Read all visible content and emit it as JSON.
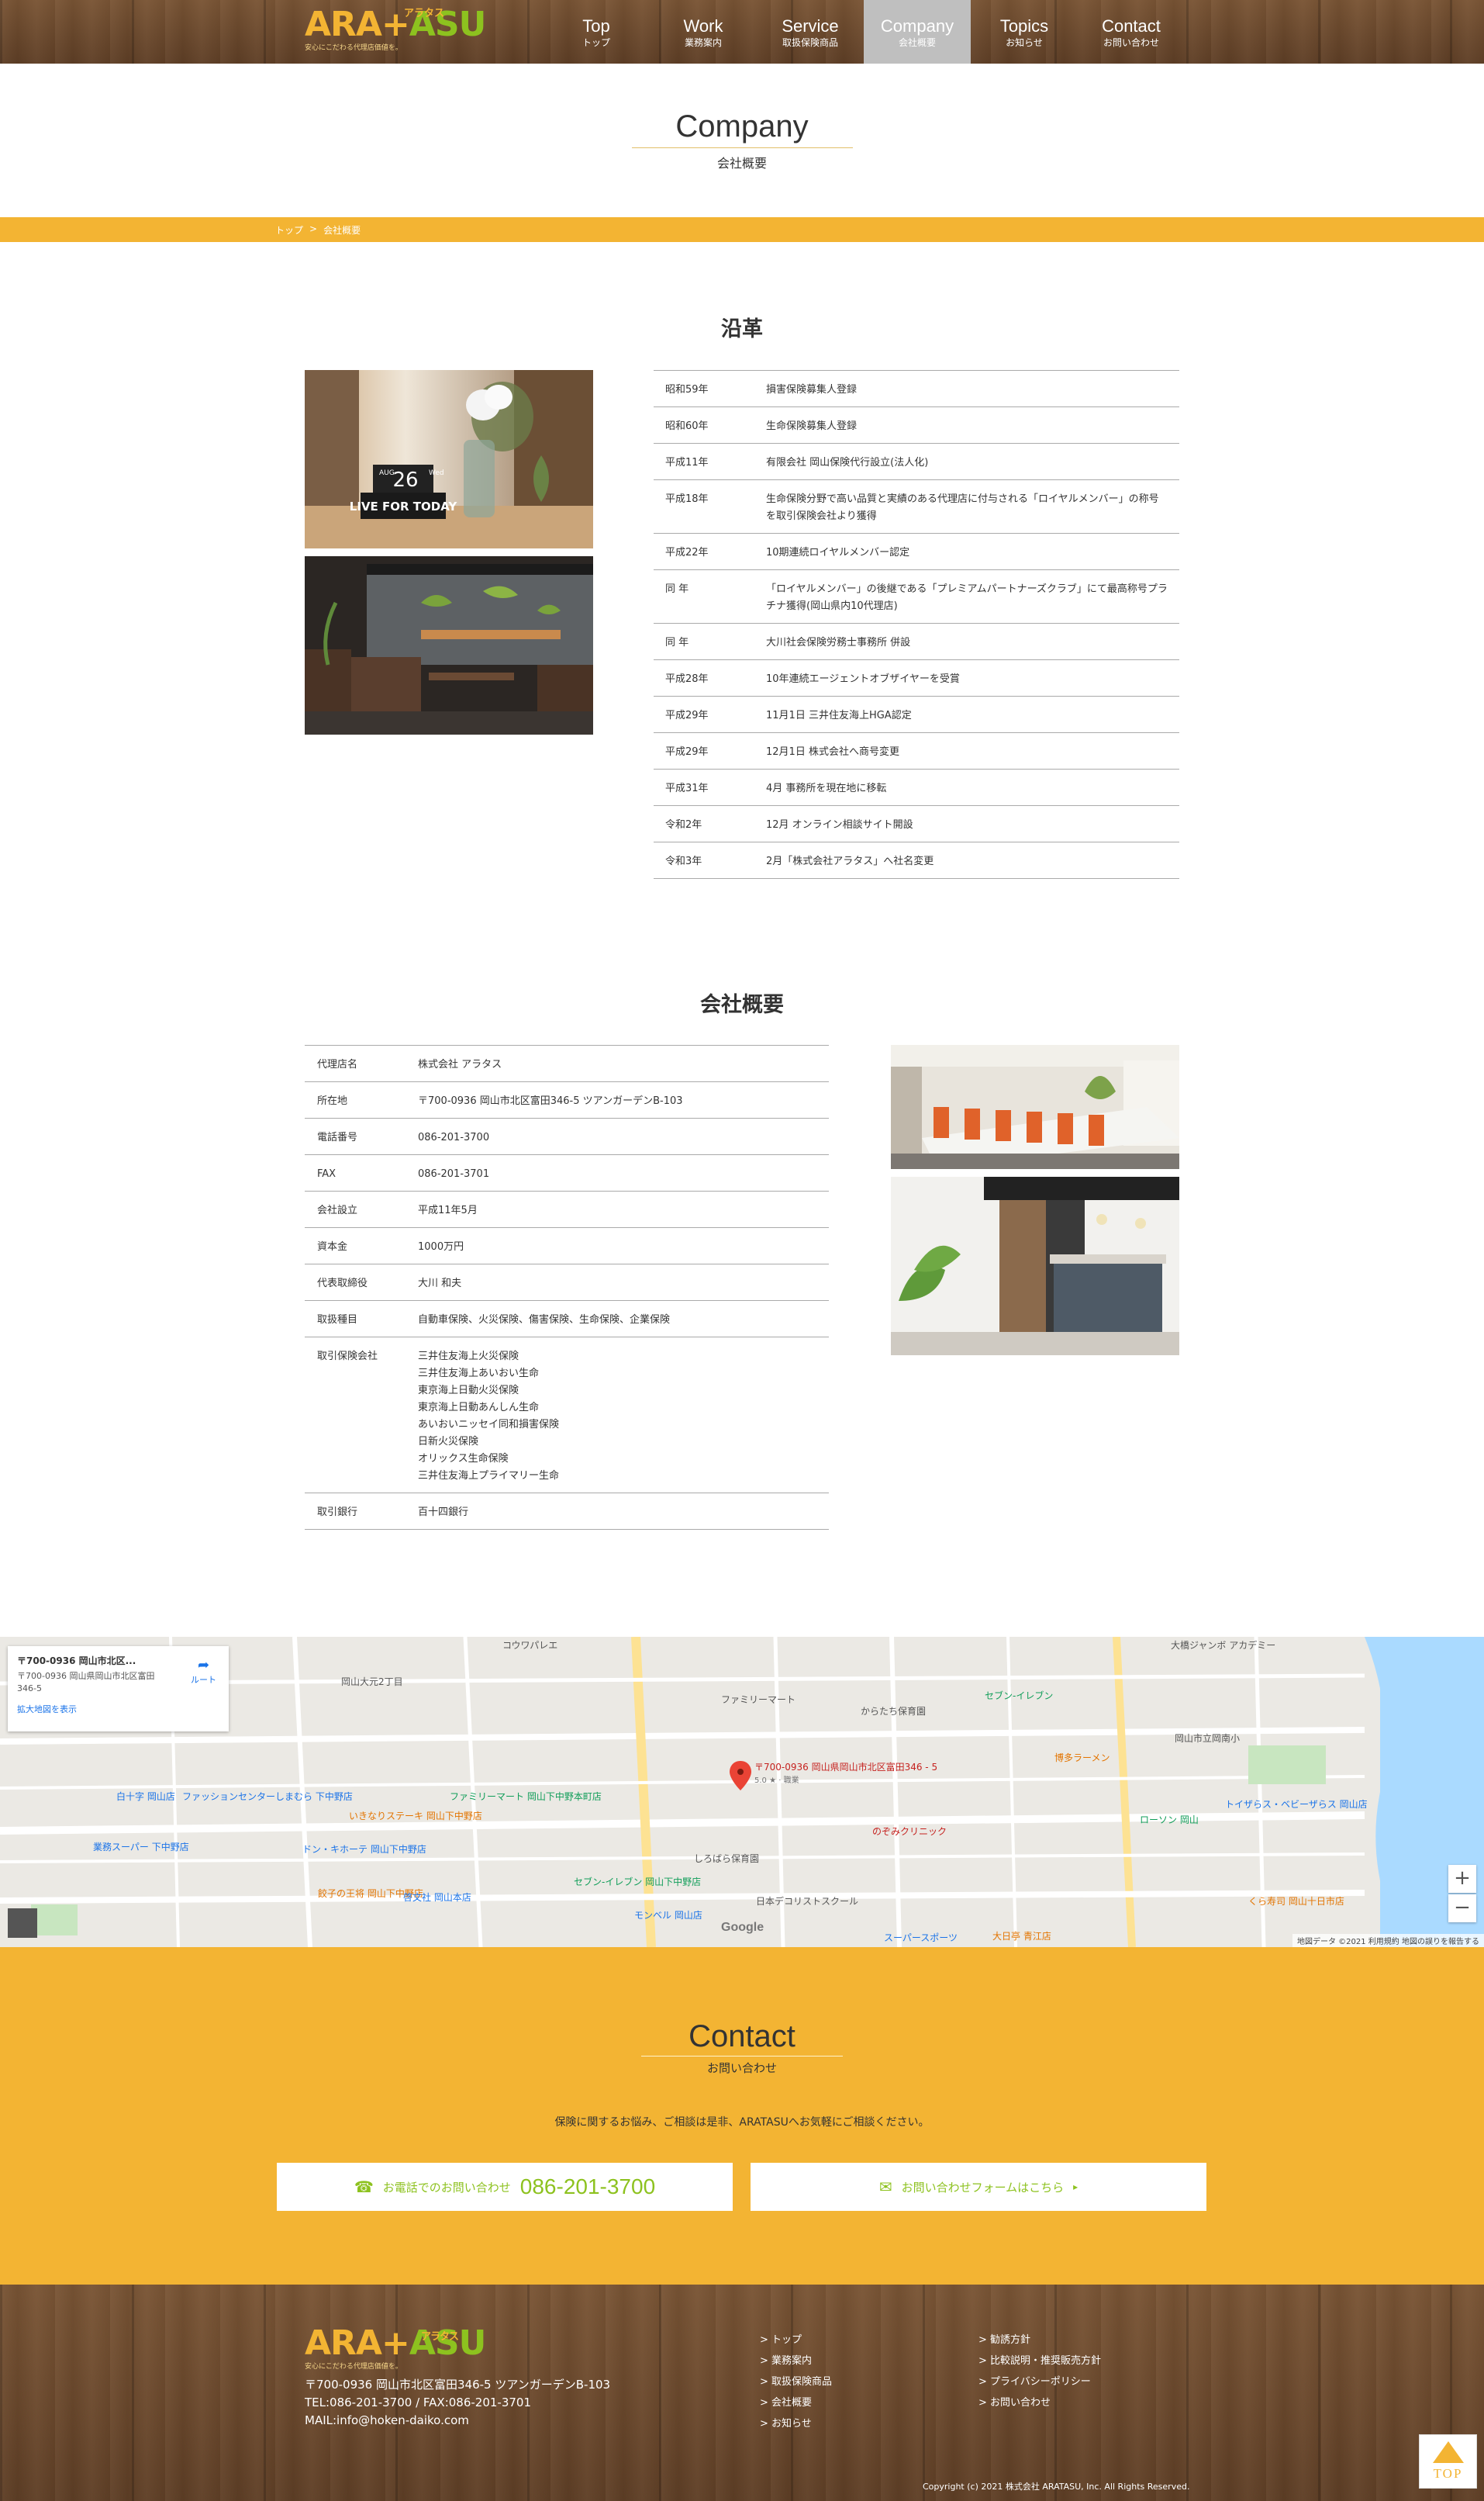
{
  "header": {
    "logo": {
      "part1": "ARA",
      "part2": "ASU",
      "plus": "+",
      "kana": "アラタス",
      "tagline": "安心にこだわる代理店価値を。"
    },
    "nav": [
      {
        "en": "Top",
        "ja": "トップ"
      },
      {
        "en": "Work",
        "ja": "業務案内"
      },
      {
        "en": "Service",
        "ja": "取扱保険商品"
      },
      {
        "en": "Company",
        "ja": "会社概要"
      },
      {
        "en": "Topics",
        "ja": "お知らせ"
      },
      {
        "en": "Contact",
        "ja": "お問い合わせ"
      }
    ]
  },
  "page_title": {
    "en": "Company",
    "ja": "会社概要"
  },
  "breadcrumb": {
    "home": "トップ",
    "sep": ">",
    "current": "会社概要"
  },
  "history": {
    "title": "沿革",
    "rows": [
      {
        "year": "昭和59年",
        "text": "損害保険募集人登録"
      },
      {
        "year": "昭和60年",
        "text": "生命保険募集人登録"
      },
      {
        "year": "平成11年",
        "text": "有限会社 岡山保険代行設立(法人化)"
      },
      {
        "year": "平成18年",
        "text": "生命保険分野で高い品質と実績のある代理店に付与される「ロイヤルメンバー」の称号を取引保険会社より獲得"
      },
      {
        "year": "平成22年",
        "text": "10期連続ロイヤルメンバー認定"
      },
      {
        "year": "同 年",
        "text": "「ロイヤルメンバー」の後継である「プレミアムパートナーズクラブ」にて最高称号プラチナ獲得(岡山県内10代理店)"
      },
      {
        "year": "同 年",
        "text": "大川社会保険労務士事務所 併設"
      },
      {
        "year": "平成28年",
        "text": "10年連続エージェントオブザイヤーを受賞"
      },
      {
        "year": "平成29年",
        "text": "11月1日 三井住友海上HGA認定"
      },
      {
        "year": "平成29年",
        "text": "12月1日 株式会社へ商号変更"
      },
      {
        "year": "平成31年",
        "text": "4月 事務所を現在地に移転"
      },
      {
        "year": "令和2年",
        "text": "12月 オンライン相談サイト開設"
      },
      {
        "year": "令和3年",
        "text": "2月「株式会社アラタス」へ社名変更"
      }
    ]
  },
  "photo_calendar": {
    "date": "26",
    "day": "Wed",
    "month": "AUG",
    "slogan": "LIVE FOR TODAY"
  },
  "overview": {
    "title": "会社概要",
    "rows": [
      {
        "label": "代理店名",
        "value": "株式会社 アラタス"
      },
      {
        "label": "所在地",
        "value": "〒700-0936 岡山市北区富田346-5 ツアンガーデンB-103"
      },
      {
        "label": "電話番号",
        "value": "086-201-3700"
      },
      {
        "label": "FAX",
        "value": "086-201-3701"
      },
      {
        "label": "会社設立",
        "value": "平成11年5月"
      },
      {
        "label": "資本金",
        "value": "1000万円"
      },
      {
        "label": "代表取締役",
        "value": "大川 和夫"
      },
      {
        "label": "取扱種目",
        "value": "自動車保険、火災保険、傷害保険、生命保険、企業保険"
      },
      {
        "label": "取引保険会社",
        "lines": [
          "三井住友海上火災保険",
          "三井住友海上あいおい生命",
          "東京海上日動火災保険",
          "東京海上日動あんしん生命",
          "あいおいニッセイ同和損害保険",
          "日新火災保険",
          "オリックス生命保険",
          "三井住友海上プライマリー生命"
        ]
      },
      {
        "label": "取引銀行",
        "value": "百十四銀行"
      }
    ]
  },
  "map": {
    "card_title": "〒700-0936 岡山市北区...",
    "card_address": "〒700-0936 岡山県岡山市北区富田 346-5",
    "card_link": "拡大地図を表示",
    "route": "ルート",
    "pin_label": "〒700-0936 岡山県岡山市北区富田346 - 5",
    "pin_sub": "5.0 ★ · 職業",
    "google": "Google",
    "attribution": "地図データ ©2021   利用規約   地図の誤りを報告する",
    "zoom_in": "+",
    "zoom_out": "−",
    "labels": [
      "コウワパレエ",
      "大橋ジャンボ アカデミー",
      "岡山大元2丁目",
      "ファミリーマート",
      "岡山市立岡南小",
      "セブン-イレブン",
      "からたち保育園",
      "博多ラーメン",
      "ローソン 岡山",
      "トイザらス・ベビーザらス 岡山店",
      "白十字 岡山店",
      "ファッションセンターしまむら 下中野店",
      "ファミリーマート 岡山下中野本町店",
      "いきなりステーキ 岡山下中野店",
      "しろばら保育園",
      "のぞみクリニック",
      "セブン-イレブン 岡山下中野店",
      "ドン・キホーテ 岡山下中野店",
      "モンベル 岡山店",
      "日本デコリストスクール",
      "くら寿司 岡山十日市店",
      "大日亭 青江店",
      "スーパースポーツ",
      "業務スーパー 下中野店",
      "餃子の王将 岡山下中野店",
      "啓文社 岡山本店"
    ]
  },
  "contact": {
    "en": "Contact",
    "ja": "お問い合わせ",
    "lead": "保険に関するお悩み、ご相談は是非、ARATASUへお気軽にご相談ください。",
    "phone_label": "お電話でのお問い合わせ",
    "phone_number": "086-201-3700",
    "form_label": "お問い合わせフォームはこちら",
    "form_arrow": "▸"
  },
  "footer": {
    "address": "〒700-0936 岡山市北区富田346-5 ツアンガーデンB-103",
    "telfax": "TEL:086-201-3700 / FAX:086-201-3701",
    "mail": "MAIL:info@hoken-daiko.com",
    "nav1": [
      "> トップ",
      "> 業務案内",
      "> 取扱保険商品",
      "> 会社概要",
      "> お知らせ"
    ],
    "nav2": [
      "> 勧誘方針",
      "> 比較説明・推奨販売方針",
      "> プライバシーポリシー",
      "> お問い合わせ"
    ],
    "copyright": "Copyright (c) 2021 株式会社 ARATASU, Inc. All Rights Reserved.",
    "totop": "TOP"
  },
  "colors": {
    "accent": "#f3b433",
    "green": "#8dc21f",
    "wood": "#6b4a2f",
    "nav_active": "#bfbfbf"
  }
}
